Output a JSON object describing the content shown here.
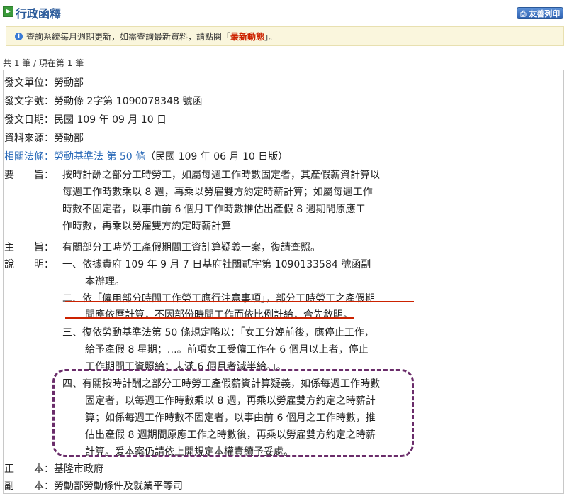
{
  "header": {
    "title": "行政函釋",
    "print_label": "友善列印"
  },
  "notice": {
    "text_before": "查詢系統每月週期更新，如需查詢最新資料，請點閱「",
    "link_label": "最新動態",
    "text_after": "」。"
  },
  "count_text": "共 1 筆 / 現在第 1 筆",
  "fields": {
    "unit_label": "發文單位：",
    "unit_value": "勞動部",
    "docno_label": "發文字號：",
    "docno_value": "勞動條 2字第 1090078348 號函",
    "date_label": "發文日期：",
    "date_value": "民國 109 年 09 月 10 日",
    "source_label": "資料來源：",
    "source_value": "勞動部",
    "law_label": "相關法條：",
    "law_link": "勞動基準法 第 50 條",
    "law_note": "（民國 109 年 06 月 10 日版）"
  },
  "summary": {
    "label": "要　　旨：",
    "lines": [
      "按時計酬之部分工時勞工，如屬每週工作時數固定者，其產假薪資計算以",
      "每週工作時數乘以 8  週，再乘以勞雇雙方約定時薪計算；如屬每週工作",
      "時數不固定者，以事由前 6  個月工作時數推估出產假 8  週期間原應工",
      "作時數，再乘以勞雇雙方約定時薪計算"
    ]
  },
  "subject": {
    "label": "主　　旨：",
    "text": "有關部分工時勞工產假期間工資計算疑義一案，復請查照。"
  },
  "explanation": {
    "label": "說　　明：",
    "items": [
      [
        "一、依據貴府 109  年 9  月 7  日基府社關貳字第 1090133584 號函副",
        "本辦理。"
      ],
      [
        "二、依「僱用部分時間工作勞工應行注意事項」，部分工時勞工之產假期",
        "間應依曆計算，不因部份時間工作而依比例計給，合先敘明。"
      ],
      [
        "三、復依勞動基準法第 50 條規定略以：「女工分娩前後，應停止工作，",
        "給予產假 8  星期；…。前項女工受僱工作在 6  個月以上者，停止",
        "工作期間工資照給；未滿 6  個月者減半給。」。"
      ],
      [
        "四、有關按時計酬之部分工時勞工產假薪資計算疑義，如係每週工作時數",
        "固定者，以每週工作時數乘以 8  週，再乘以勞雇雙方約定之時薪計",
        "算；如係每週工作時數不固定者，以事由前 6  個月之工作時數，推",
        "估出產假 8  週期間原應工作之時數後，再乘以勞雇雙方約定之時薪",
        "計算。爰本案仍請依上開規定本權責續予妥處。"
      ]
    ]
  },
  "recipients": {
    "main_label": "正　　本：",
    "main_value": "基隆市政府",
    "copy_label": "副　　本：",
    "copy_value": "勞動部勞動條件及就業平等司"
  },
  "colors": {
    "title_blue": "#2a5a9a",
    "link_blue": "#2a6ab8",
    "notice_red": "#cc2200",
    "annotation_purple": "#6a2c6a"
  }
}
